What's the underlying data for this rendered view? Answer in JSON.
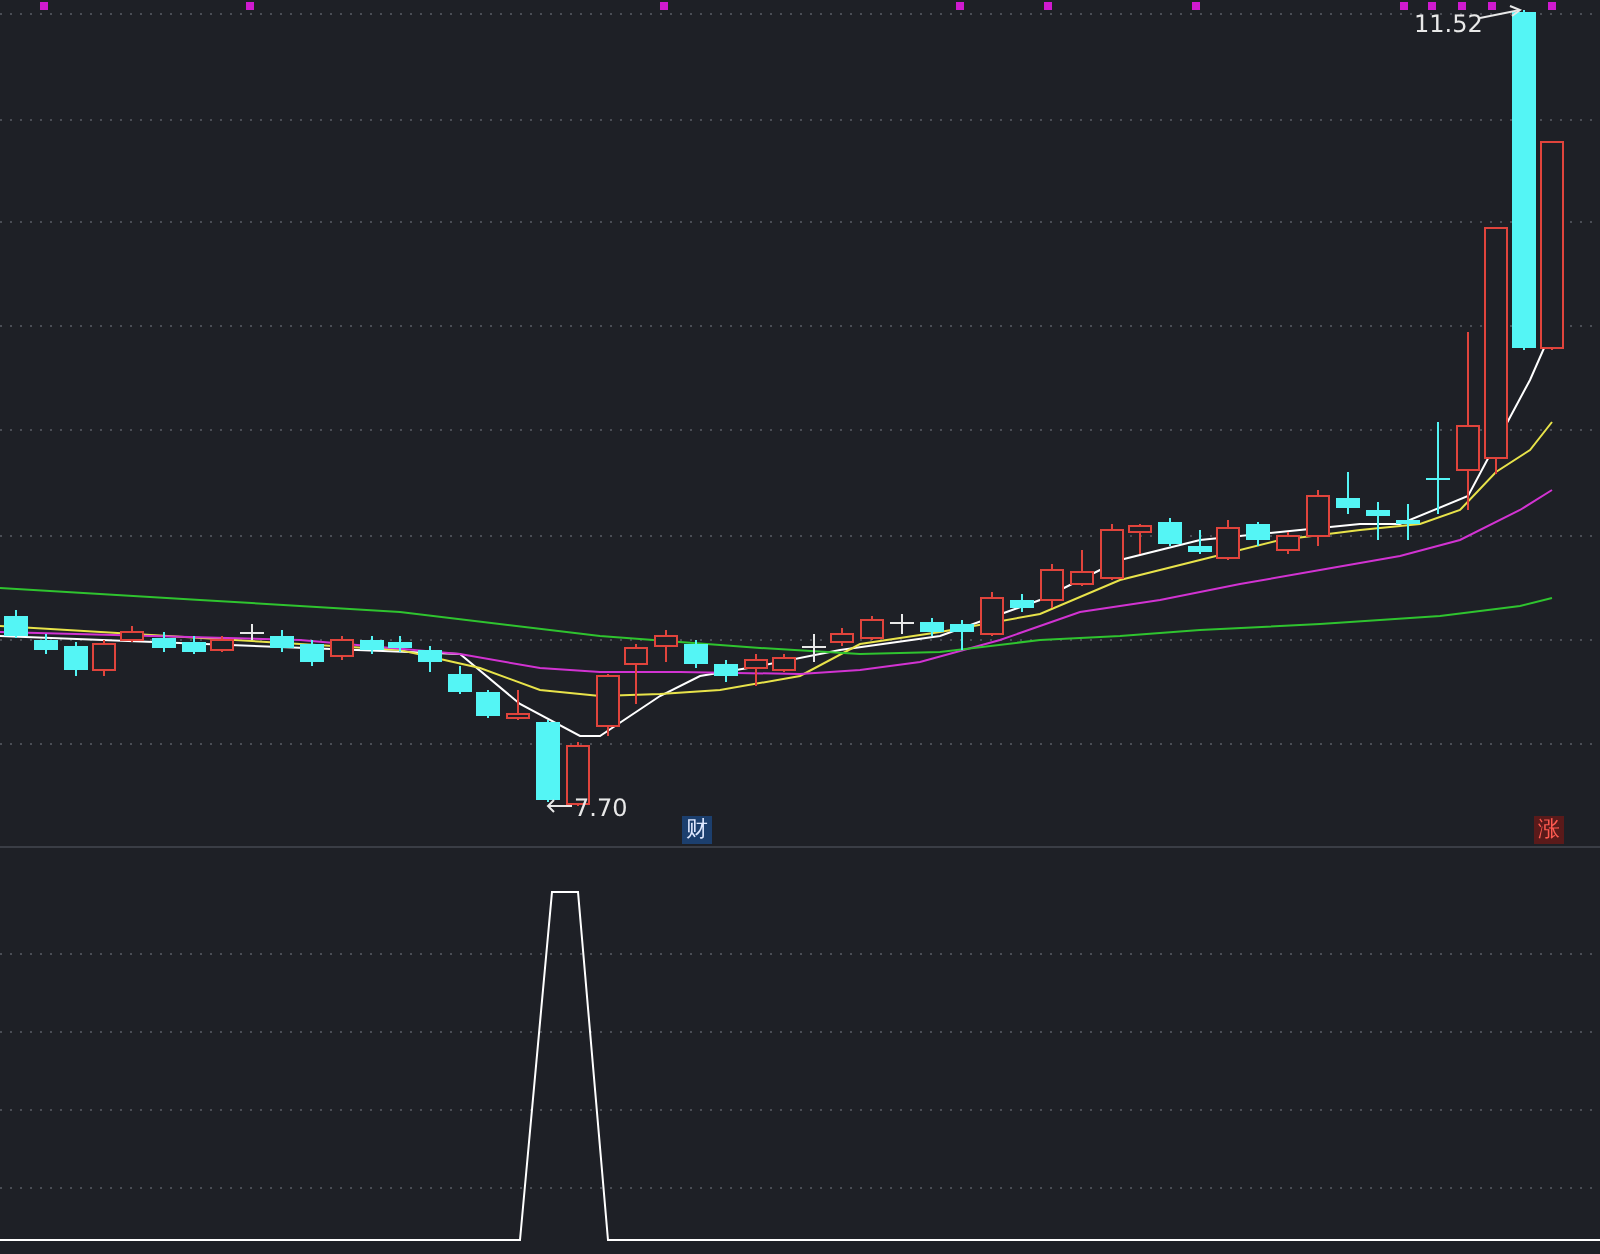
{
  "main_chart": {
    "high_label": "11.52",
    "low_label": "7.70",
    "markers": [
      {
        "text": "财",
        "kind": "finance",
        "color": "#1c3f6e"
      },
      {
        "text": "涨",
        "kind": "limit-up",
        "color": "#5a1a1a"
      }
    ]
  }
}
